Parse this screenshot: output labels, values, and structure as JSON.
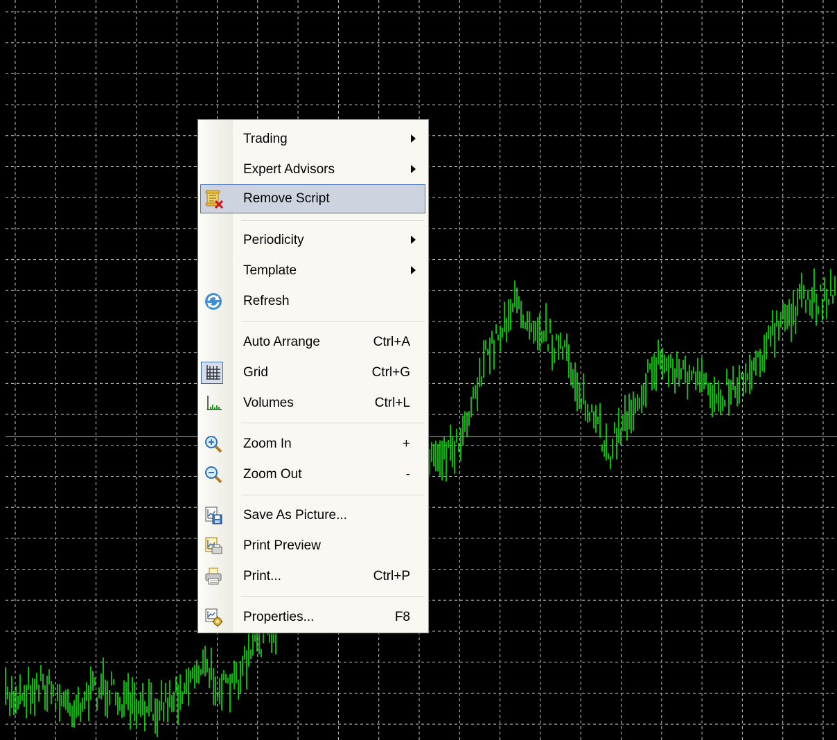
{
  "colors": {
    "background": "#000000",
    "grid": "#c8c8c8",
    "bars": "#00ff00",
    "price_line": "#b8b8b8",
    "menu_bg": "#f9f8f3",
    "menu_highlight": "#cdd4e0",
    "menu_highlight_border": "#3f6db5"
  },
  "menu": {
    "items": [
      {
        "label": "Trading",
        "submenu": true
      },
      {
        "label": "Expert Advisors",
        "submenu": true
      },
      {
        "label": "Remove Script",
        "icon": "remove-script-icon",
        "highlighted": true
      },
      {
        "label": "Periodicity",
        "submenu": true
      },
      {
        "label": "Template",
        "submenu": true
      },
      {
        "label": "Refresh",
        "icon": "refresh-icon"
      },
      {
        "label": "Auto Arrange",
        "shortcut": "Ctrl+A"
      },
      {
        "label": "Grid",
        "shortcut": "Ctrl+G",
        "icon": "grid-icon",
        "checked": true
      },
      {
        "label": "Volumes",
        "shortcut": "Ctrl+L",
        "icon": "volumes-icon"
      },
      {
        "label": "Zoom In",
        "shortcut": "+",
        "icon": "zoom-in-icon"
      },
      {
        "label": "Zoom Out",
        "shortcut": "-",
        "icon": "zoom-out-icon"
      },
      {
        "label": "Save As Picture...",
        "icon": "save-picture-icon"
      },
      {
        "label": "Print Preview",
        "icon": "print-preview-icon"
      },
      {
        "label": "Print...",
        "shortcut": "Ctrl+P",
        "icon": "printer-icon"
      },
      {
        "label": "Properties...",
        "shortcut": "F8",
        "icon": "properties-icon"
      }
    ]
  }
}
